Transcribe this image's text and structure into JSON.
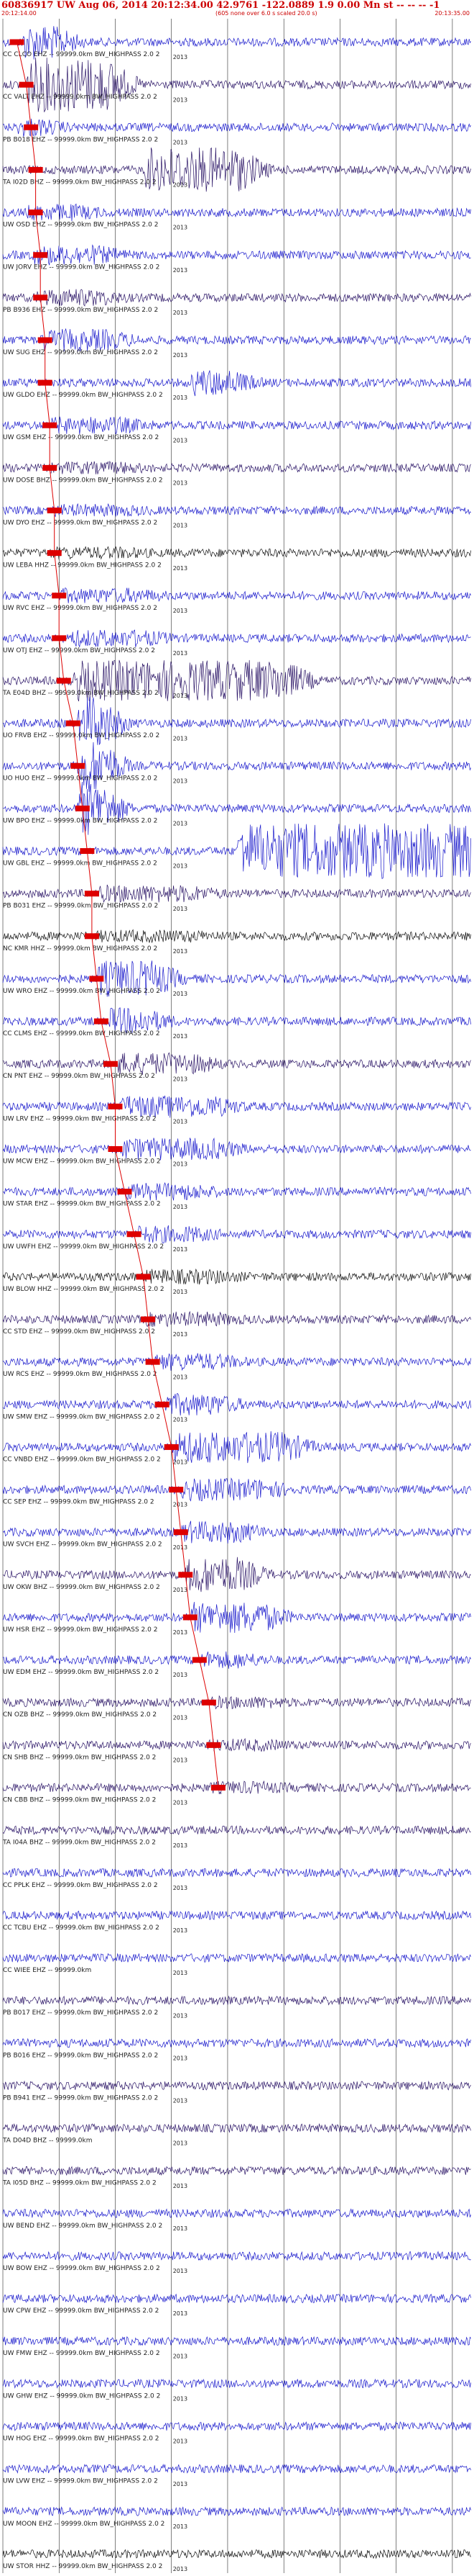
{
  "header": {
    "title": "60836917 UW Aug 06, 2014 20:12:34.00   42.9761  -122.0889  1.9 0.00 Mn st -- -- -- -1",
    "start_time": "20:12:14.00",
    "note": "(605 none over 6.0 s scaled 20.0 s)",
    "end_time": "20:13:35.00"
  },
  "colors": {
    "trace_a": "#1a1acc",
    "trace_b": "#2a1466",
    "trace_c": "#111111",
    "pick": "#dd0000",
    "grid": "#000000"
  },
  "chart_data": {
    "type": "line",
    "year_label": "2013",
    "traces": [
      {
        "label": "CC CLCO EHZ -- 99999.0km BW_HIGHPASS  2.0  2",
        "color": "a",
        "burst": [
          0.04,
          0.1,
          0.6
        ],
        "pick": 0.03
      },
      {
        "label": "CC VALT EHZ -- 99999.0km BW_HIGHPASS  2.0  2",
        "color": "b",
        "burst": [
          0.05,
          0.22,
          1.0
        ],
        "pick": 0.05
      },
      {
        "label": "PB B018 EHZ -- 99999.0km BW_HIGHPASS  2.0  2",
        "color": "a",
        "burst": [
          0.03,
          0.07,
          0.25
        ],
        "pick": 0.06
      },
      {
        "label": "TA I02D BHZ -- 99999.0km BW_HIGHPASS  2.0  2",
        "color": "b",
        "burst": [
          0.3,
          0.5,
          0.8
        ],
        "pick": 0.07
      },
      {
        "label": "UW OSD EHZ -- 99999.0km BW_HIGHPASS  2.0  2",
        "color": "a",
        "burst": [
          0.05,
          0.15,
          0.2
        ],
        "pick": 0.07
      },
      {
        "label": "UW JORV EHZ -- 99999.0km BW_HIGHPASS  2.0  2",
        "color": "a",
        "burst": [
          0.06,
          0.2,
          0.25
        ],
        "pick": 0.08
      },
      {
        "label": "PB B936 EHZ -- 99999.0km BW_HIGHPASS  2.0  2",
        "color": "b",
        "burst": [
          0.07,
          0.2,
          0.2
        ],
        "pick": 0.08
      },
      {
        "label": "UW SUG EHZ -- 99999.0km BW_HIGHPASS  2.0  2",
        "color": "a",
        "burst": [
          0.08,
          0.22,
          0.3
        ],
        "pick": 0.09
      },
      {
        "label": "UW GLDO EHZ -- 99999.0km BW_HIGHPASS  2.0  2",
        "color": "a",
        "burst": [
          0.4,
          0.48,
          0.4
        ],
        "pick": 0.09
      },
      {
        "label": "UW GSM EHZ -- 99999.0km BW_HIGHPASS  2.0  2",
        "color": "a",
        "burst": [
          0.1,
          0.25,
          0.2
        ],
        "pick": 0.1
      },
      {
        "label": "UW DOSE BHZ -- 99999.0km BW_HIGHPASS  2.0  2",
        "color": "b",
        "burst": [
          0.1,
          0.25,
          0.1
        ],
        "pick": 0.1
      },
      {
        "label": "UW DYO EHZ -- 99999.0km BW_HIGHPASS  2.0  2",
        "color": "a",
        "burst": [
          0.1,
          0.25,
          0.1
        ],
        "pick": 0.11
      },
      {
        "label": "UW LEBA HHZ -- 99999.0km BW_HIGHPASS  2.0  2",
        "color": "c",
        "burst": [
          0.1,
          0.25,
          0.1
        ],
        "pick": 0.11
      },
      {
        "label": "UW RVC EHZ -- 99999.0km BW_HIGHPASS  2.0  2",
        "color": "a",
        "burst": [
          0.12,
          0.28,
          0.15
        ],
        "pick": 0.12
      },
      {
        "label": "UW OTJ EHZ -- 99999.0km BW_HIGHPASS  2.0  2",
        "color": "a",
        "burst": [
          0.14,
          0.3,
          0.2
        ],
        "pick": 0.12
      },
      {
        "label": "TA E04D BHZ -- 99999.0km BW_HIGHPASS  2.0  2",
        "color": "b",
        "burst": [
          0.15,
          0.6,
          0.7
        ],
        "pick": 0.13
      },
      {
        "label": "UO FRVB EHZ -- 99999.0km BW_HIGHPASS  2.0  2",
        "color": "a",
        "burst": [
          0.16,
          0.2,
          1.0
        ],
        "pick": 0.15
      },
      {
        "label": "UO HUO EHZ -- 99999.0km BW_HIGHPASS  2.0  2",
        "color": "a",
        "burst": [
          0.16,
          0.2,
          1.0
        ],
        "pick": 0.16
      },
      {
        "label": "UW BPO EHZ -- 99999.0km BW_HIGHPASS  2.0  2",
        "color": "a",
        "burst": [
          0.16,
          0.2,
          1.0
        ],
        "pick": 0.17
      },
      {
        "label": "UW GBL EHZ -- 99999.0km BW_HIGHPASS  2.0  2",
        "color": "a",
        "burst": [
          0.5,
          1.0,
          1.0
        ],
        "pick": 0.18
      },
      {
        "label": "PB B031 EHZ -- 99999.0km BW_HIGHPASS  2.0  2",
        "color": "b",
        "burst": [
          0.2,
          0.4,
          0.2
        ],
        "pick": 0.19
      },
      {
        "label": "NC KMR HHZ -- 99999.0km BW_HIGHPASS  2.0  2",
        "color": "c",
        "burst": [
          0.2,
          0.4,
          0.1
        ],
        "pick": 0.19
      },
      {
        "label": "UW WRO EHZ -- 99999.0km BW_HIGHPASS  2.0  2",
        "color": "a",
        "burst": [
          0.2,
          0.32,
          0.6
        ],
        "pick": 0.2
      },
      {
        "label": "CC CLMS EHZ -- 99999.0km BW_HIGHPASS  2.0  2",
        "color": "a",
        "burst": [
          0.22,
          0.3,
          0.4
        ],
        "pick": 0.21
      },
      {
        "label": "CN PNT EHZ -- 99999.0km BW_HIGHPASS  2.0  2",
        "color": "b",
        "burst": [
          0.24,
          0.4,
          0.3
        ],
        "pick": 0.23
      },
      {
        "label": "UW LRV EHZ -- 99999.0km BW_HIGHPASS  2.0  2",
        "color": "a",
        "burst": [
          0.25,
          0.45,
          0.3
        ],
        "pick": 0.24
      },
      {
        "label": "UW MCW EHZ -- 99999.0km BW_HIGHPASS  2.0  2",
        "color": "a",
        "burst": [
          0.25,
          0.45,
          0.3
        ],
        "pick": 0.24
      },
      {
        "label": "UW STAR EHZ -- 99999.0km BW_HIGHPASS  2.0  2",
        "color": "a",
        "burst": [
          0.26,
          0.4,
          0.2
        ],
        "pick": 0.26
      },
      {
        "label": "UW UWFH EHZ -- 99999.0km BW_HIGHPASS  2.0  2",
        "color": "a",
        "burst": [
          0.28,
          0.4,
          0.2
        ],
        "pick": 0.28
      },
      {
        "label": "UW BLOW HHZ -- 99999.0km BW_HIGHPASS  2.0  2",
        "color": "c",
        "burst": [
          0.3,
          0.45,
          0.15
        ],
        "pick": 0.3
      },
      {
        "label": "CC STD EHZ -- 99999.0km BW_HIGHPASS  2.0  2",
        "color": "b",
        "burst": [
          0.3,
          0.45,
          0.15
        ],
        "pick": 0.31
      },
      {
        "label": "UW RCS EHZ -- 99999.0km BW_HIGHPASS  2.0  2",
        "color": "a",
        "burst": [
          0.32,
          0.45,
          0.2
        ],
        "pick": 0.32
      },
      {
        "label": "UW SMW EHZ -- 99999.0km BW_HIGHPASS  2.0  2",
        "color": "a",
        "burst": [
          0.34,
          0.45,
          0.3
        ],
        "pick": 0.34
      },
      {
        "label": "CC VNBD EHZ -- 99999.0km BW_HIGHPASS  2.0  2",
        "color": "a",
        "burst": [
          0.36,
          0.6,
          0.5
        ],
        "pick": 0.36
      },
      {
        "label": "CC SEP EHZ -- 99999.0km BW_HIGHPASS  2.0  2",
        "color": "a",
        "burst": [
          0.38,
          0.55,
          0.3
        ],
        "pick": 0.37
      },
      {
        "label": "UW SVCH EHZ -- 99999.0km BW_HIGHPASS  2.0  2",
        "color": "a",
        "burst": [
          0.38,
          0.5,
          0.3
        ],
        "pick": 0.38
      },
      {
        "label": "UW OKW BHZ -- 99999.0km BW_HIGHPASS  2.0  2",
        "color": "b",
        "burst": [
          0.39,
          0.5,
          0.6
        ],
        "pick": 0.39
      },
      {
        "label": "UW HSR EHZ -- 99999.0km BW_HIGHPASS  2.0  2",
        "color": "a",
        "burst": [
          0.4,
          0.55,
          0.5
        ],
        "pick": 0.4
      },
      {
        "label": "UW EDM EHZ -- 99999.0km BW_HIGHPASS  2.0  2",
        "color": "a",
        "burst": [
          0.42,
          0.5,
          0.2
        ],
        "pick": 0.42
      },
      {
        "label": "CN OZB BHZ -- 99999.0km BW_HIGHPASS  2.0  2",
        "color": "b",
        "burst": [
          0.44,
          0.55,
          0.1
        ],
        "pick": 0.44
      },
      {
        "label": "CN SHB BHZ -- 99999.0km BW_HIGHPASS  2.0  2",
        "color": "b",
        "burst": [
          0.44,
          0.55,
          0.1
        ],
        "pick": 0.45
      },
      {
        "label": "CN CBB BHZ -- 99999.0km BW_HIGHPASS  2.0  2",
        "color": "b",
        "burst": [
          0.44,
          0.55,
          0.1
        ],
        "pick": 0.46
      },
      {
        "label": "TA I04A BHZ -- 99999.0km BW_HIGHPASS  2.0  2",
        "color": "b",
        "burst": [
          0,
          0,
          0
        ],
        "pick": null
      },
      {
        "label": "CC PPLK EHZ -- 99999.0km BW_HIGHPASS  2.0  2",
        "color": "a",
        "burst": [
          0,
          0,
          0
        ],
        "pick": null
      },
      {
        "label": "CC TCBU EHZ -- 99999.0km BW_HIGHPASS  2.0  2",
        "color": "a",
        "burst": [
          0,
          0,
          0
        ],
        "pick": null
      },
      {
        "label": "CC WIEE EHZ -- 99999.0km",
        "color": "a",
        "burst": [
          0,
          0,
          0
        ],
        "pick": null
      },
      {
        "label": "PB B017 EHZ -- 99999.0km BW_HIGHPASS  2.0  2",
        "color": "b",
        "burst": [
          0,
          0,
          0
        ],
        "pick": null
      },
      {
        "label": "PB B016 EHZ -- 99999.0km BW_HIGHPASS  2.0  2",
        "color": "a",
        "burst": [
          0,
          0,
          0
        ],
        "pick": null
      },
      {
        "label": "PB B941 EHZ -- 99999.0km BW_HIGHPASS  2.0  2",
        "color": "b",
        "burst": [
          0,
          0,
          0
        ],
        "pick": null
      },
      {
        "label": "TA D04D BHZ -- 99999.0km",
        "color": "b",
        "burst": [
          0,
          0,
          0
        ],
        "pick": null
      },
      {
        "label": "TA I05D BHZ -- 99999.0km BW_HIGHPASS  2.0  2",
        "color": "b",
        "burst": [
          0,
          0,
          0
        ],
        "pick": null
      },
      {
        "label": "UW BEND EHZ -- 99999.0km BW_HIGHPASS  2.0  2",
        "color": "a",
        "burst": [
          0,
          0,
          0
        ],
        "pick": null
      },
      {
        "label": "UW BOW EHZ -- 99999.0km BW_HIGHPASS  2.0  2",
        "color": "a",
        "burst": [
          0,
          0,
          0
        ],
        "pick": null
      },
      {
        "label": "UW CPW EHZ -- 99999.0km BW_HIGHPASS  2.0  2",
        "color": "a",
        "burst": [
          0,
          0,
          0
        ],
        "pick": null
      },
      {
        "label": "UW FMW EHZ -- 99999.0km BW_HIGHPASS  2.0  2",
        "color": "a",
        "burst": [
          0,
          0,
          0
        ],
        "pick": null
      },
      {
        "label": "UW GHW EHZ -- 99999.0km BW_HIGHPASS  2.0  2",
        "color": "a",
        "burst": [
          0,
          0,
          0
        ],
        "pick": null
      },
      {
        "label": "UW HOG EHZ -- 99999.0km BW_HIGHPASS  2.0  2",
        "color": "a",
        "burst": [
          0,
          0,
          0
        ],
        "pick": null
      },
      {
        "label": "UW LVW EHZ -- 99999.0km BW_HIGHPASS  2.0  2",
        "color": "a",
        "burst": [
          0,
          0,
          0
        ],
        "pick": null
      },
      {
        "label": "UW MOON EHZ -- 99999.0km BW_HIGHPASS  2.0  2",
        "color": "a",
        "burst": [
          0,
          0,
          0
        ],
        "pick": null
      },
      {
        "label": "UW STOR HHZ -- 99999.0km BW_HIGHPASS  2.0  2",
        "color": "c",
        "burst": [
          0,
          0,
          0
        ],
        "pick": null
      }
    ]
  }
}
